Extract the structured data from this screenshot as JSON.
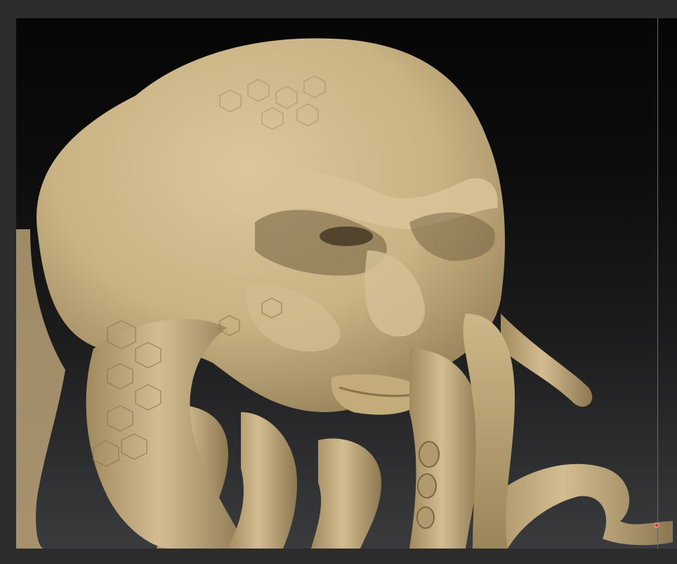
{
  "app": {
    "name": "",
    "viewport_label": ""
  },
  "viewport": {
    "background_top": "#060606",
    "background_bottom": "#3a3b3d",
    "model_color": "#c9b283",
    "model_shadow": "#7f6a47",
    "model_highlight": "#ddc99f",
    "frame_color": "#2c2c2c",
    "marker_color": "#d2332c"
  },
  "subject": {
    "icon": "sculpt-model-icon"
  }
}
